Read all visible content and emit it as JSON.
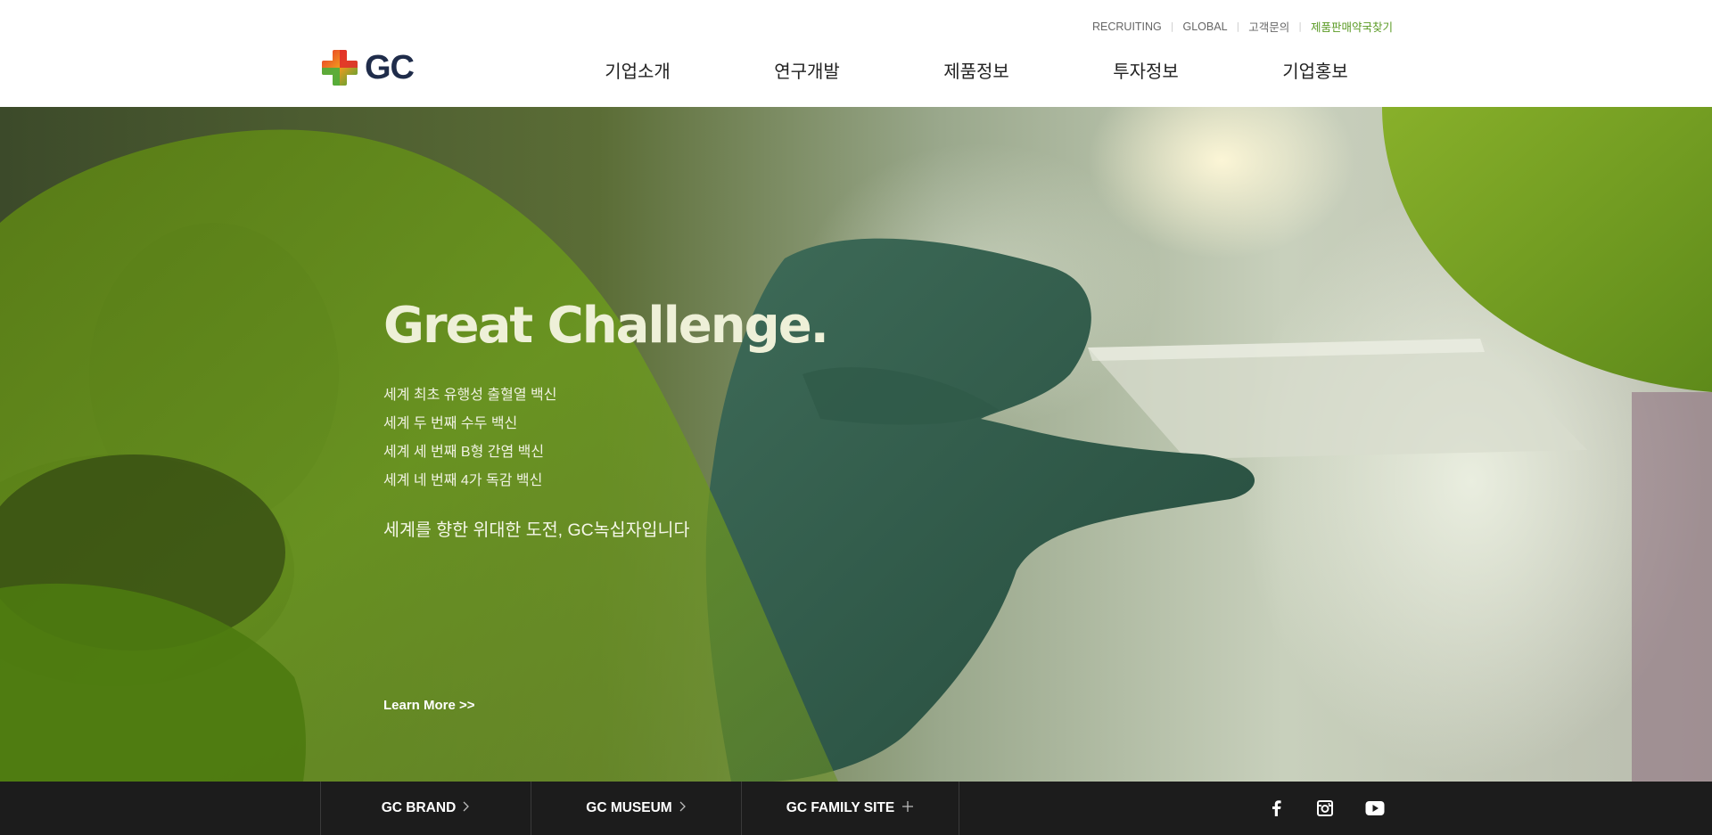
{
  "header": {
    "logo_text": "GC",
    "util_links": [
      {
        "label": "RECRUITING"
      },
      {
        "label": "GLOBAL"
      },
      {
        "label": "고객문의"
      },
      {
        "label": "제품판매약국찾기"
      }
    ],
    "nav": [
      {
        "label": "기업소개"
      },
      {
        "label": "연구개발"
      },
      {
        "label": "제품정보"
      },
      {
        "label": "투자정보"
      },
      {
        "label": "기업홍보"
      }
    ]
  },
  "hero": {
    "title": "Great Challenge.",
    "lines": [
      "세계 최초 유행성 출혈열 백신",
      "세계 두 번째 수두 백신",
      "세계 세 번째 B형 간염 백신",
      "세계 네 번째 4가 독감 백신"
    ],
    "slogan": "세계를 향한 위대한 도전, GC녹십자입니다",
    "learn_more": "Learn More >>"
  },
  "footer": {
    "links": [
      {
        "label": "GC BRAND",
        "icon": "chevron-right-icon"
      },
      {
        "label": "GC MUSEUM",
        "icon": "chevron-right-icon"
      },
      {
        "label": "GC FAMILY SITE",
        "icon": "plus-icon"
      }
    ],
    "social": [
      "facebook-icon",
      "instagram-icon",
      "youtube-icon"
    ]
  },
  "colors": {
    "accent_green": "#5a9a24",
    "footer_bg": "#1c1c1c",
    "logo_navy": "#1f2c4a"
  }
}
